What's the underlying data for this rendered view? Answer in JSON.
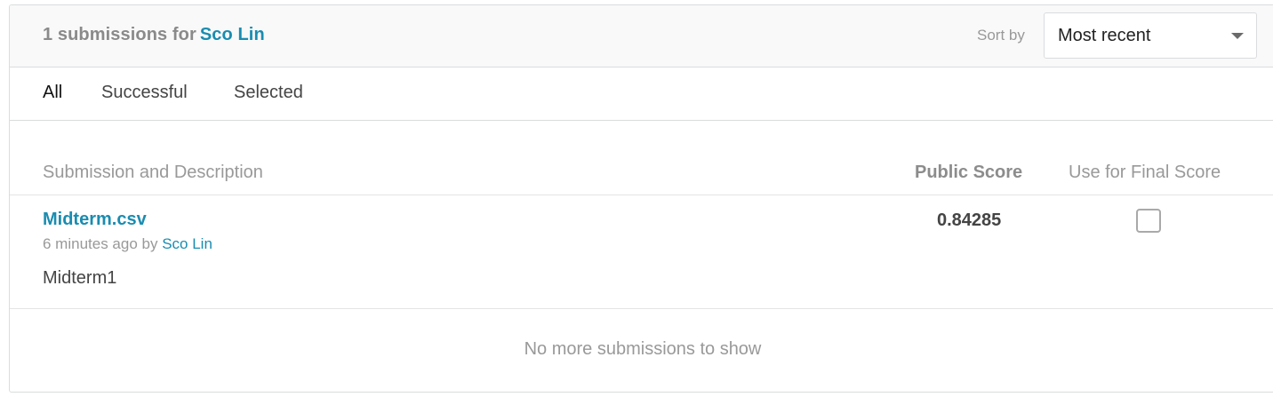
{
  "header": {
    "count_text": "1 submissions for",
    "user_name": "Sco Lin",
    "sort_label": "Sort by",
    "sort_value": "Most recent"
  },
  "tabs": [
    {
      "label": "All",
      "active": true
    },
    {
      "label": "Successful",
      "active": false
    },
    {
      "label": "Selected",
      "active": false
    }
  ],
  "table": {
    "columns": {
      "submission": "Submission and Description",
      "public_score": "Public Score",
      "final_score": "Use for Final Score"
    },
    "rows": [
      {
        "file_name": "Midterm.csv",
        "time_text": "6 minutes ago by",
        "author": "Sco Lin",
        "description": "Midterm1",
        "public_score": "0.84285",
        "use_for_final": false
      }
    ]
  },
  "footer": {
    "message": "No more submissions to show"
  },
  "colors": {
    "link": "#1a8cb0",
    "muted": "#999999",
    "border": "#dadcdd"
  }
}
